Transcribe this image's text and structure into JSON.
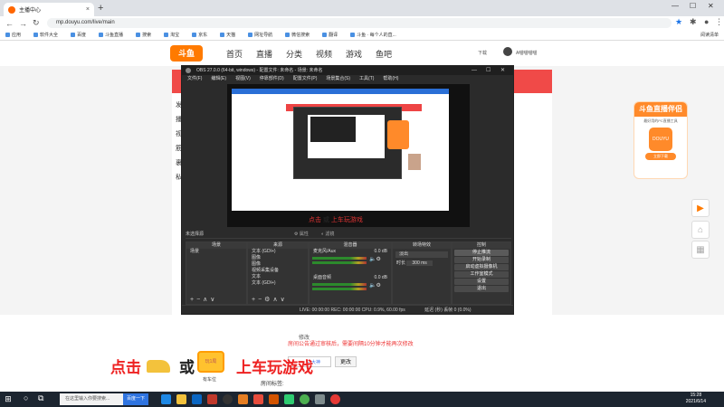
{
  "browser": {
    "tab_title": "主播中心",
    "url": "mp.douyu.com/live/main",
    "bookmarks": [
      "应用",
      "软件大全",
      "百度",
      "斗鱼直播",
      "搜索",
      "淘宝",
      "京东",
      "天猫",
      "网址导航",
      "微信搜索",
      "翻译",
      "斗鱼 · 每个人的直..."
    ],
    "reading_list": "阅读清单"
  },
  "douyu": {
    "logo": "斗鱼",
    "nav": [
      "首页",
      "直播",
      "分类",
      "视频",
      "游戏",
      "鱼吧"
    ],
    "download": "下载",
    "user": "A喵喵喵喵"
  },
  "obs": {
    "title": "OBS 27.0.0 (64-bit, windows) - 配置文件: 未命名 - 场景: 未命名",
    "menu": [
      "文件(F)",
      "编辑(E)",
      "视图(V)",
      "停靠部件(D)",
      "配置文件(P)",
      "场景集合(S)",
      "工具(T)",
      "帮助(H)"
    ],
    "preview_caption_red": "点击",
    "preview_caption_dark": "或",
    "preview_caption_tail": "上车玩游戏",
    "no_source": "未选择源",
    "properties": "属性",
    "filters": "滤镜",
    "docks": {
      "scenes": "场景",
      "sources": "来源",
      "mixer": "混音器",
      "transitions": "转场特效",
      "controls": "控制"
    },
    "scene_item": "场景",
    "source_items": [
      "文本 (GDI+)",
      "图像",
      "图像",
      "视频采集设备",
      "文本",
      "文本 (GDI+)"
    ],
    "mixer_items": [
      {
        "name": "麦克风/Aux",
        "db": "0.0 dB"
      },
      {
        "name": "桌面音频",
        "db": "0.0 dB"
      }
    ],
    "transition_type": "淡出",
    "duration_label": "时长",
    "duration_value": "300 ms",
    "controls": [
      "停止推流",
      "开始录制",
      "启动虚拟摄像机",
      "工作室模式",
      "设置",
      "退出"
    ],
    "status": "LIVE: 00:00:00   REC: 00:00:00   CPU: 0.9%, 60.00 fps",
    "status_right": "延迟 (秒) 丢帧 0 (0.0%)"
  },
  "promo": {
    "title": "斗鱼直播伴侣",
    "desc": "最好用的PC直播工具",
    "logo": "DOUYU",
    "button": "立即下载"
  },
  "bottom": {
    "tip1": "修改",
    "red_notice": "房间公告通过审核后，需要间隔10分钟才能再次修改",
    "input_link": "三大神",
    "more_button": "更改",
    "footer_label": "房间标签:"
  },
  "overlay": {
    "red_text": "点击",
    "dark_text": "或",
    "tail_text": "上车玩游戏",
    "card_label": "有车位",
    "card_inner": "玩1局"
  },
  "taskbar": {
    "search_placeholder": "在这里输入你要搜索...",
    "search_button": "百度一下",
    "time": "15:28",
    "date": "2021/6/14"
  }
}
